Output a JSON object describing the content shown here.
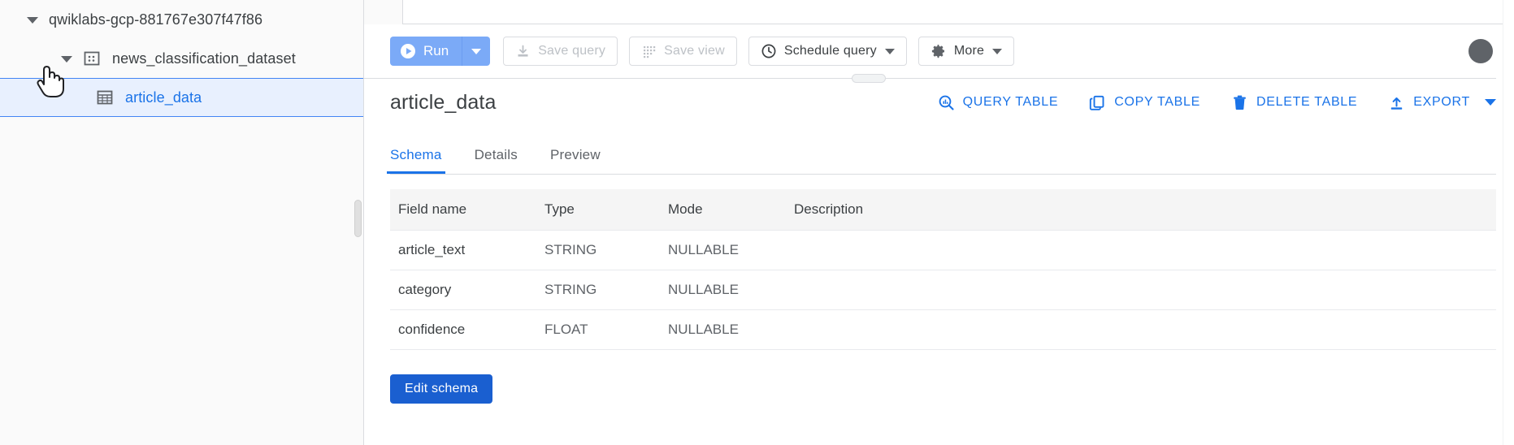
{
  "sidebar": {
    "tree": [
      {
        "label": "qwiklabs-gcp-881767e307f47f86",
        "level": 0,
        "icon": "caret-down-icon",
        "type": "project",
        "expanded": true,
        "selected": false
      },
      {
        "label": "news_classification_dataset",
        "level": 1,
        "icon": "dataset-icon",
        "type": "dataset",
        "expanded": true,
        "selected": false
      },
      {
        "label": "article_data",
        "level": 2,
        "icon": "table-icon",
        "type": "table",
        "expanded": false,
        "selected": true
      }
    ],
    "cursor": "pointer-hand-cursor"
  },
  "toolbar": {
    "run_label": "Run",
    "run_icon": "play-circle-icon",
    "run_dropdown_icon": "chevron-down-icon",
    "save_query_label": "Save query",
    "save_query_icon": "save-download-icon",
    "save_query_disabled": true,
    "save_view_label": "Save view",
    "save_view_icon": "grid-dots-icon",
    "save_view_disabled": true,
    "schedule_query_label": "Schedule query",
    "schedule_query_icon": "clock-icon",
    "more_label": "More",
    "more_icon": "gear-icon",
    "avatar": "user-avatar"
  },
  "table_header": {
    "title": "article_data",
    "actions": [
      {
        "label": "QUERY TABLE",
        "icon": "query-magnifier-icon"
      },
      {
        "label": "COPY TABLE",
        "icon": "copy-icon"
      },
      {
        "label": "DELETE TABLE",
        "icon": "trash-icon"
      },
      {
        "label": "EXPORT",
        "icon": "export-upload-icon"
      }
    ],
    "export_dropdown_icon": "chevron-down-icon"
  },
  "tabs": [
    {
      "label": "Schema",
      "active": true
    },
    {
      "label": "Details",
      "active": false
    },
    {
      "label": "Preview",
      "active": false
    }
  ],
  "schema": {
    "columns": [
      "Field name",
      "Type",
      "Mode",
      "Description"
    ],
    "rows": [
      {
        "field": "article_text",
        "type": "STRING",
        "mode": "NULLABLE",
        "description": ""
      },
      {
        "field": "category",
        "type": "STRING",
        "mode": "NULLABLE",
        "description": ""
      },
      {
        "field": "confidence",
        "type": "FLOAT",
        "mode": "NULLABLE",
        "description": ""
      }
    ],
    "edit_button_label": "Edit schema"
  },
  "colors": {
    "accent_blue": "#1a73e8",
    "run_blue": "#7baaf7",
    "edit_blue": "#1a5fd0",
    "selected_row_bg": "#e8f0fe",
    "sidebar_bg": "#fafafa",
    "border": "#dadce0"
  }
}
